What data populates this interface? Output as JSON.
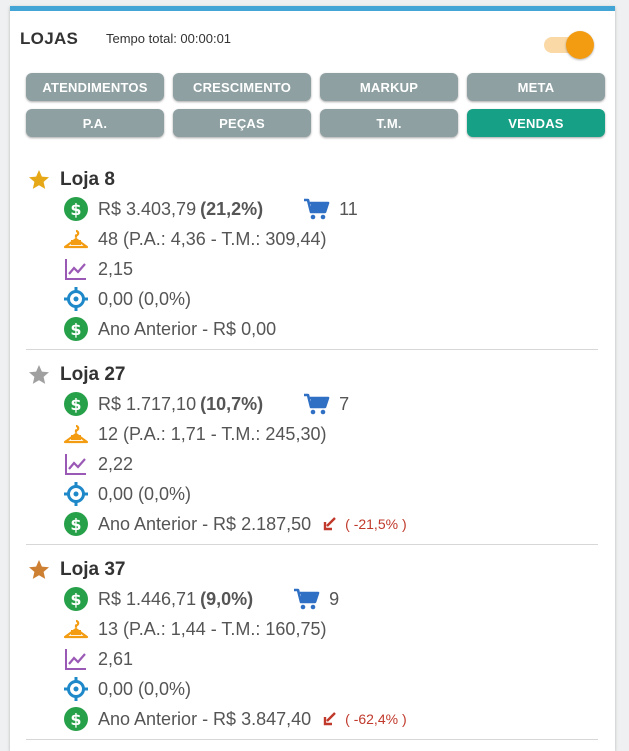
{
  "header": {
    "title": "LOJAS",
    "timer": "Tempo total: 00:00:01",
    "toggle_on": true
  },
  "tabs": [
    {
      "label": "ATENDIMENTOS",
      "active": false
    },
    {
      "label": "CRESCIMENTO",
      "active": false
    },
    {
      "label": "MARKUP",
      "active": false
    },
    {
      "label": "META",
      "active": false
    },
    {
      "label": "P.A.",
      "active": false
    },
    {
      "label": "PEÇAS",
      "active": false
    },
    {
      "label": "T.M.",
      "active": false
    },
    {
      "label": "VENDAS",
      "active": true
    }
  ],
  "colors": {
    "accent_bar": "#42a5d6",
    "tab_inactive": "#8fa0a2",
    "tab_active": "#16a085",
    "toggle": "#f39c12",
    "money_icon": "#27a04a",
    "cart_icon": "#2f6fc4",
    "pieces_icon": "#f39c12",
    "chart_icon": "#9b59b6",
    "target_icon": "#1e88c8",
    "decline": "#c0392b",
    "star_gold": "#e6a817",
    "star_silver": "#a0a0a0",
    "star_bronze": "#cd7f32"
  },
  "stores": [
    {
      "name": "Loja 8",
      "star": "star-gold-icon",
      "sales": "R$ 3.403,79",
      "sales_pct": "(21,2%)",
      "orders": "11",
      "pieces": "48 (P.A.: 4,36  -  T.M.: 309,44)",
      "markup": "2,15",
      "target": "0,00 (0,0%)",
      "last_year": " Ano Anterior - R$ 0,00",
      "change": ""
    },
    {
      "name": "Loja 27",
      "star": "star-silver-icon",
      "sales": "R$ 1.717,10",
      "sales_pct": "(10,7%)",
      "orders": "7",
      "pieces": "12 (P.A.: 1,71  -  T.M.: 245,30)",
      "markup": "2,22",
      "target": "0,00 (0,0%)",
      "last_year": "Ano Anterior - R$ 2.187,50",
      "change": "( -21,5% )"
    },
    {
      "name": "Loja 37",
      "star": "star-bronze-icon",
      "sales": "R$ 1.446,71",
      "sales_pct": "(9,0%)",
      "orders": "9",
      "pieces": "13 (P.A.: 1,44  -  T.M.: 160,75)",
      "markup": "2,61",
      "target": "0,00 (0,0%)",
      "last_year": "Ano Anterior - R$ 3.847,40",
      "change": "( -62,4% )"
    }
  ]
}
